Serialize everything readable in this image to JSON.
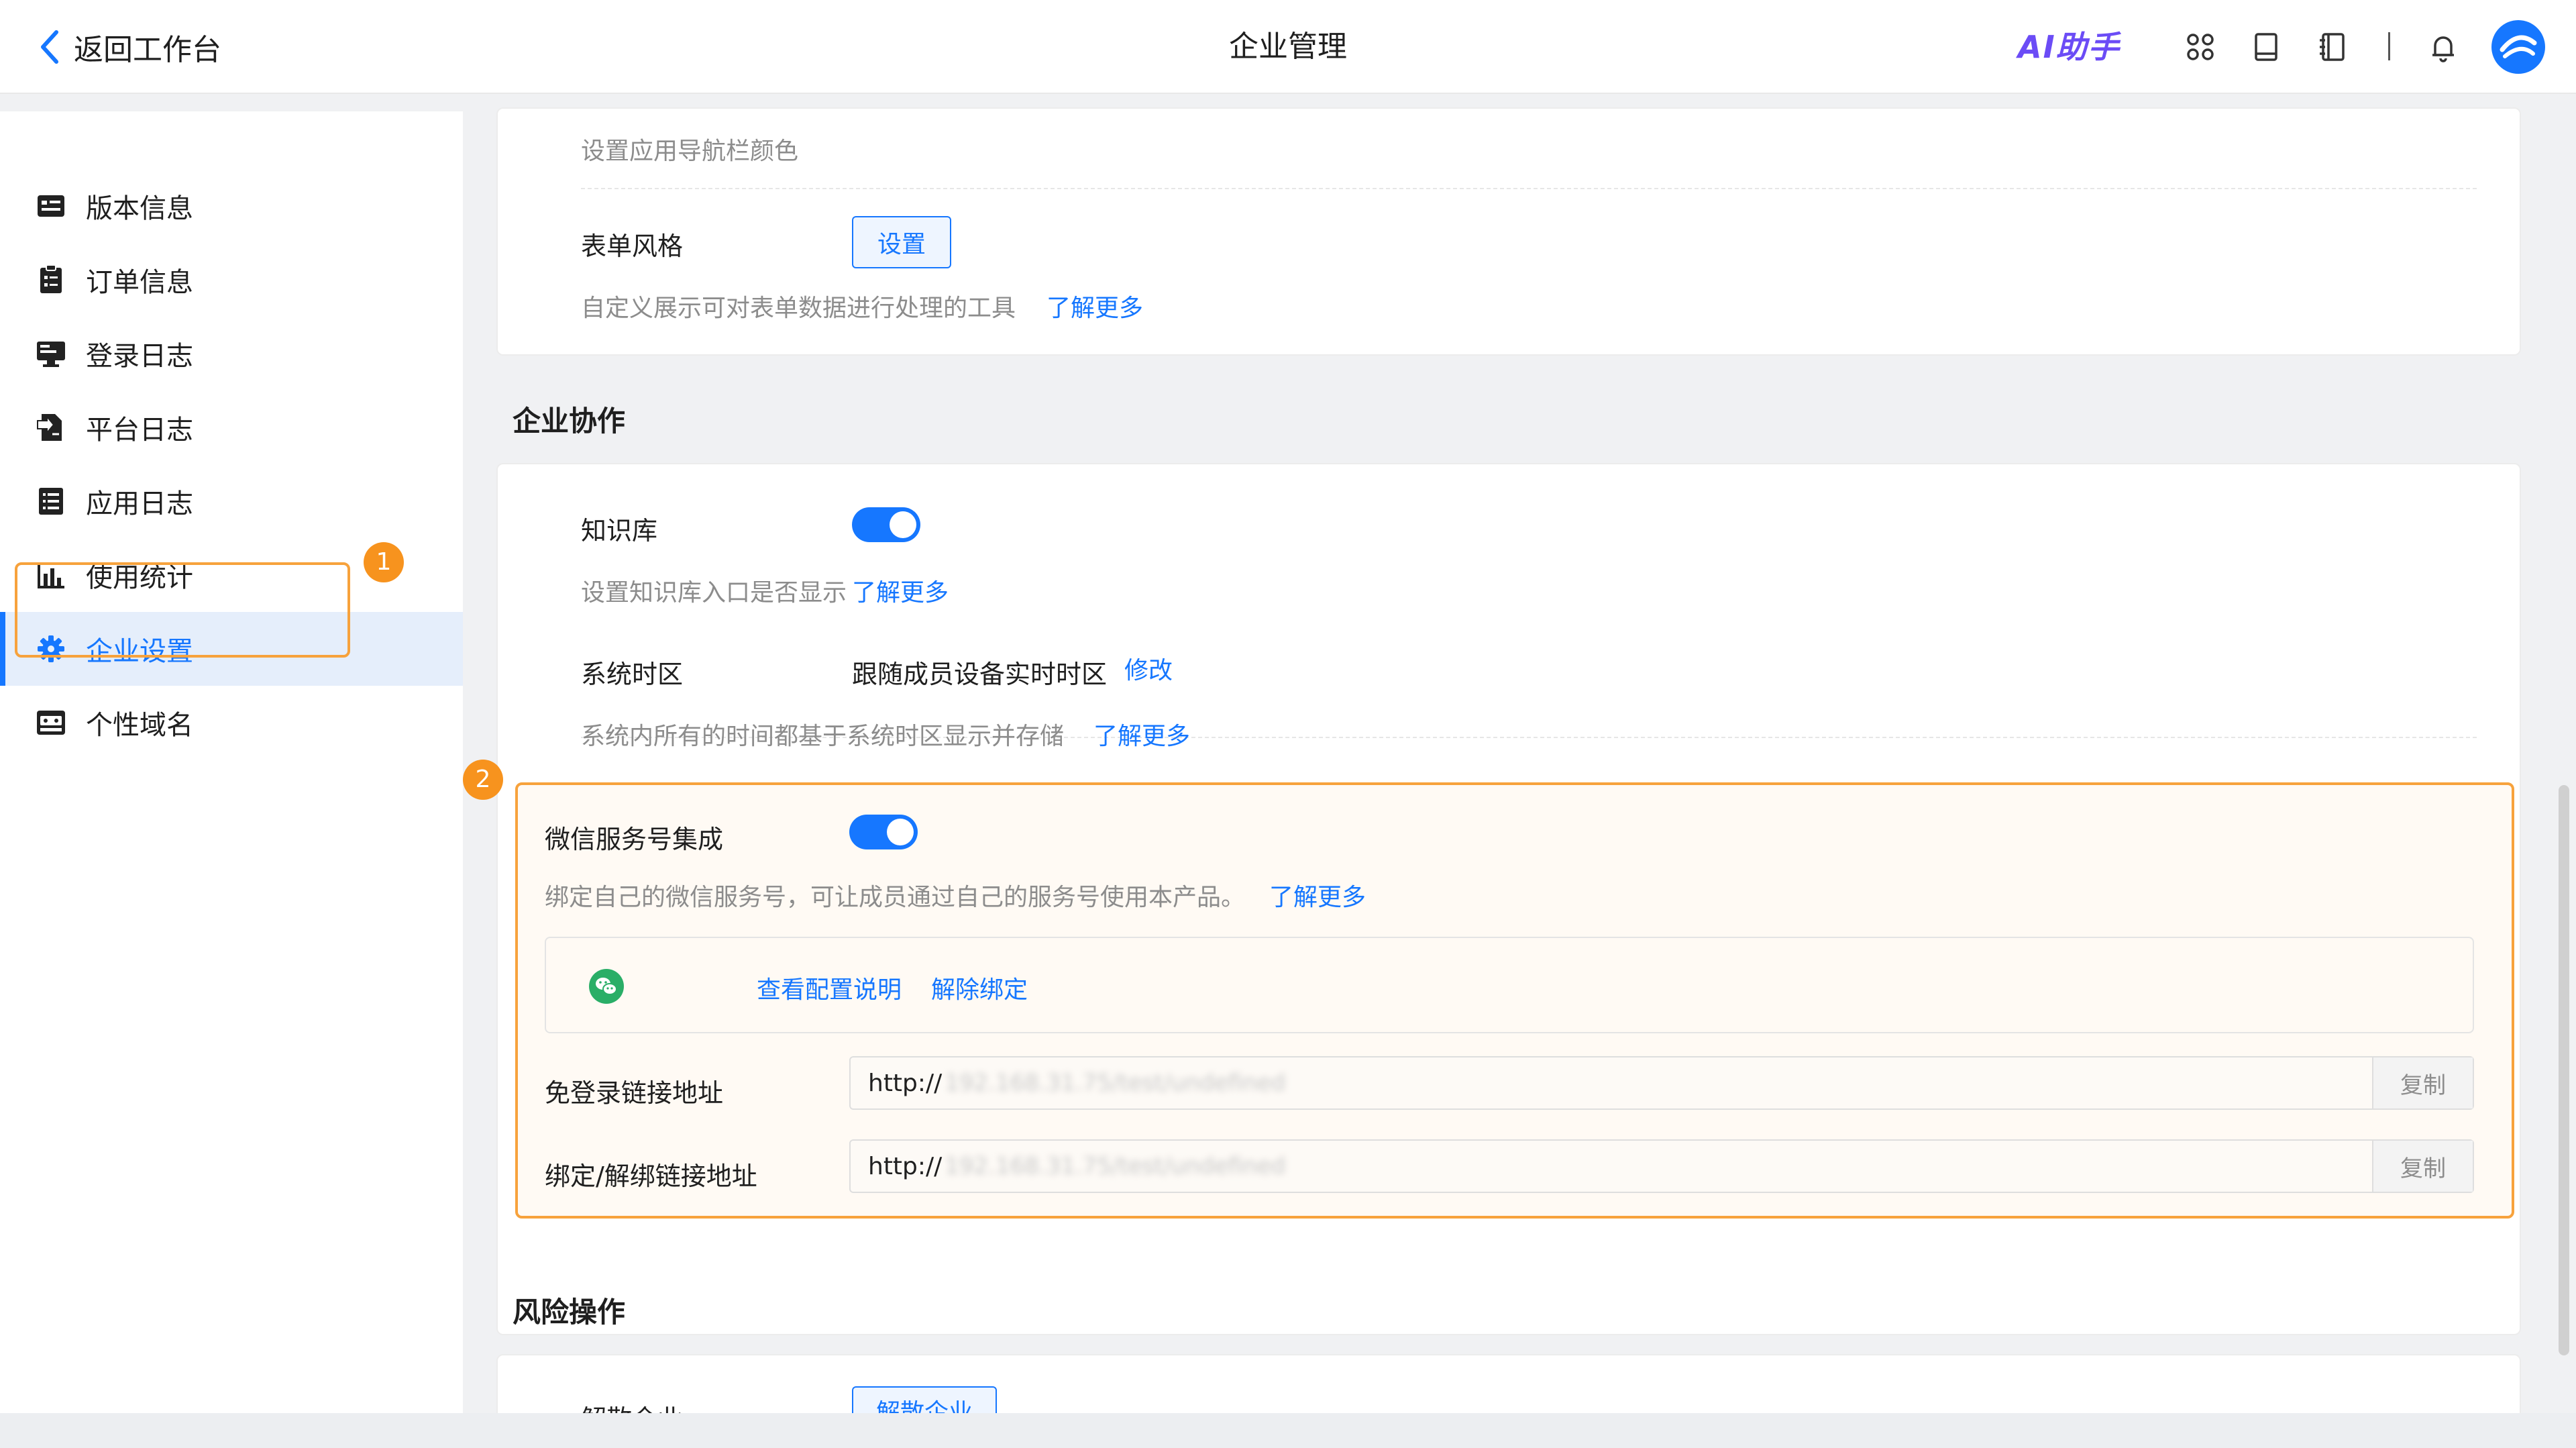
{
  "header": {
    "back_label": "返回工作台",
    "title": "企业管理",
    "ai_label": "AI助手",
    "icons": [
      "apps-icon",
      "book-icon",
      "notebook-icon",
      "bell-icon",
      "avatar-logo"
    ]
  },
  "sidebar": {
    "items": [
      {
        "label": "版本信息",
        "icon": "version-icon"
      },
      {
        "label": "订单信息",
        "icon": "order-icon"
      },
      {
        "label": "登录日志",
        "icon": "login-log-icon"
      },
      {
        "label": "平台日志",
        "icon": "platform-log-icon"
      },
      {
        "label": "应用日志",
        "icon": "app-log-icon"
      },
      {
        "label": "使用统计",
        "icon": "stats-icon"
      },
      {
        "label": "企业设置",
        "icon": "gear-icon",
        "active": true
      },
      {
        "label": "个性域名",
        "icon": "domain-icon"
      }
    ],
    "callout_1": "1"
  },
  "form_section": {
    "nav_color_desc": "设置应用导航栏颜色",
    "form_style_label": "表单风格",
    "form_style_button": "设置",
    "form_style_desc": "自定义展示可对表单数据进行处理的工具",
    "form_style_link": "了解更多"
  },
  "collab_section": {
    "title": "企业协作",
    "kb_label": "知识库",
    "kb_enabled": true,
    "kb_desc": "设置知识库入口是否显示",
    "kb_link": "了解更多",
    "tz_label": "系统时区",
    "tz_value": "跟随成员设备实时时区",
    "tz_edit": "修改",
    "tz_desc": "系统内所有的时间都基于系统时区显示并存储",
    "tz_link": "了解更多"
  },
  "wechat_section": {
    "callout_2": "2",
    "label": "微信服务号集成",
    "enabled": true,
    "desc": "绑定自己的微信服务号，可让成员通过自己的服务号使用本产品。",
    "link": "了解更多",
    "view_config": "查看配置说明",
    "unbind": "解除绑定",
    "login_url_label": "免登录链接地址",
    "login_url_prefix": "http://",
    "login_url_rest": "192.168.31.75/test/undefined",
    "login_copy": "复制",
    "bind_url_label": "绑定/解绑链接地址",
    "bind_url_prefix": "http://",
    "bind_url_rest": "192.168.31.75/test/undefined",
    "bind_copy": "复制"
  },
  "risk_section": {
    "title": "风险操作",
    "dissolve_label": "解散企业",
    "dissolve_button": "解散企业"
  },
  "colors": {
    "accent": "#1677ff",
    "highlight": "#f7a23c",
    "callout": "#f7931e",
    "ai": "#6b4cf6"
  }
}
